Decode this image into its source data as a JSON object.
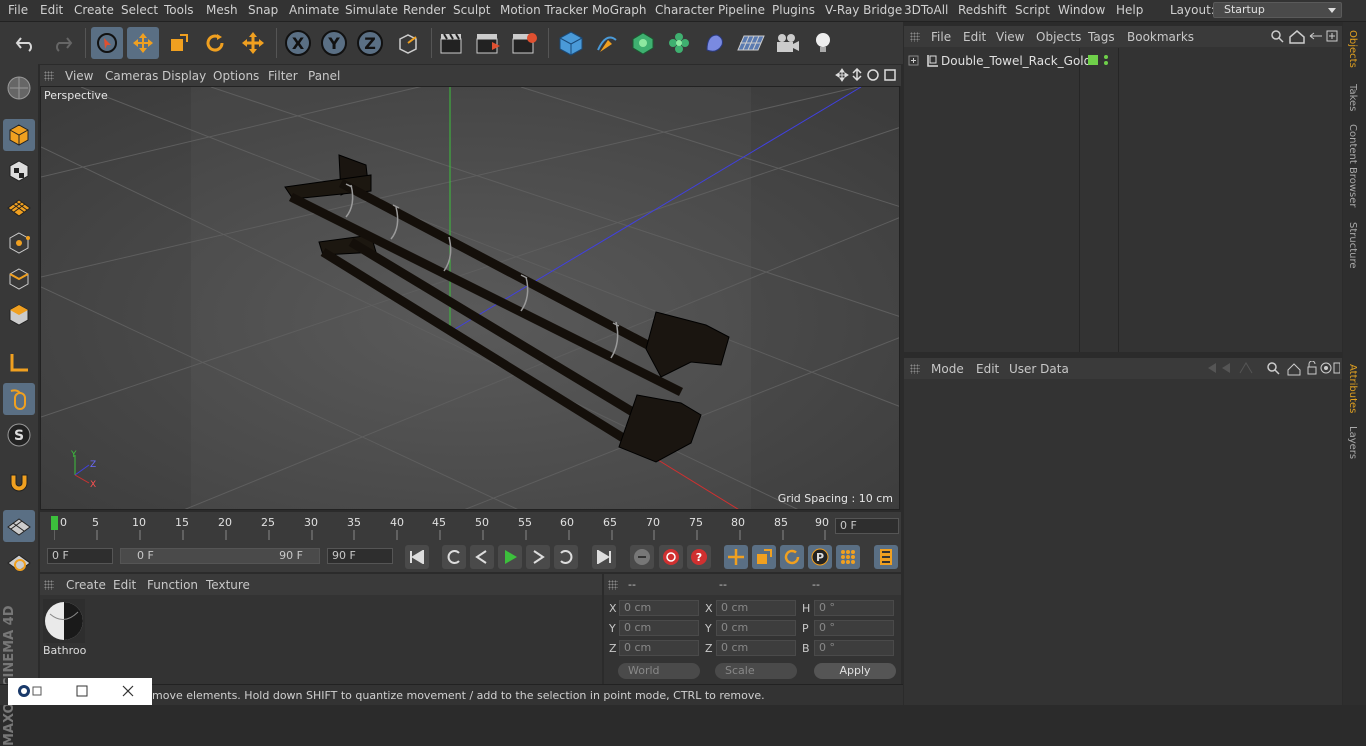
{
  "menubar": {
    "items": [
      "File",
      "Edit",
      "Create",
      "Select",
      "Tools",
      "Mesh",
      "Snap",
      "Animate",
      "Simulate",
      "Render",
      "Sculpt",
      "Motion Tracker",
      "MoGraph",
      "Character",
      "Pipeline",
      "Plugins",
      "V-Ray Bridge",
      "3DToAll",
      "Redshift",
      "Script",
      "Window",
      "Help"
    ],
    "layout_label": "Layout:",
    "layout_value": "Startup"
  },
  "viewport": {
    "menu": [
      "View",
      "Cameras",
      "Display",
      "Options",
      "Filter",
      "Panel"
    ],
    "label": "Perspective",
    "grid_spacing": "Grid Spacing : 10 cm",
    "axis_x": "X",
    "axis_y": "Y",
    "axis_z": "Z"
  },
  "timeline": {
    "ticks": [
      "0",
      "5",
      "10",
      "15",
      "20",
      "25",
      "30",
      "35",
      "40",
      "45",
      "50",
      "55",
      "60",
      "65",
      "70",
      "75",
      "80",
      "85",
      "90"
    ],
    "current_frame": "0 F"
  },
  "playbar": {
    "start_frame": "0 F",
    "range_start": "0 F",
    "range_end": "90 F",
    "end_frame": "90 F"
  },
  "materials": {
    "menu": [
      "Create",
      "Edit",
      "Function",
      "Texture"
    ],
    "items": [
      {
        "label": "Bathroo"
      }
    ]
  },
  "coords": {
    "headers": [
      "--",
      "--",
      "--"
    ],
    "rows": [
      {
        "l1": "X",
        "v1": "0 cm",
        "l2": "X",
        "v2": "0 cm",
        "l3": "H",
        "v3": "0 °"
      },
      {
        "l1": "Y",
        "v1": "0 cm",
        "l2": "Y",
        "v2": "0 cm",
        "l3": "P",
        "v3": "0 °"
      },
      {
        "l1": "Z",
        "v1": "0 cm",
        "l2": "Z",
        "v2": "0 cm",
        "l3": "B",
        "v3": "0 °"
      }
    ],
    "world": "World",
    "scale": "Scale",
    "apply": "Apply"
  },
  "objects": {
    "menu": [
      "File",
      "Edit",
      "View",
      "Objects",
      "Tags",
      "Bookmarks"
    ],
    "tree": [
      {
        "name": "Double_Towel_Rack_Gold"
      }
    ]
  },
  "attributes": {
    "menu": [
      "Mode",
      "Edit",
      "User Data"
    ]
  },
  "right_tabs": [
    "Objects",
    "Takes",
    "Content Browser",
    "Structure",
    "Attributes",
    "Layers"
  ],
  "status": {
    "text": "move elements. Hold down SHIFT to quantize movement / add to the selection in point mode, CTRL to remove."
  },
  "brand": {
    "logo": "MAXON CINEMA 4D"
  },
  "colors": {
    "accent": "#5a6f84",
    "selected_tab": "#e0a020",
    "tag_green": "#6fd04a"
  }
}
